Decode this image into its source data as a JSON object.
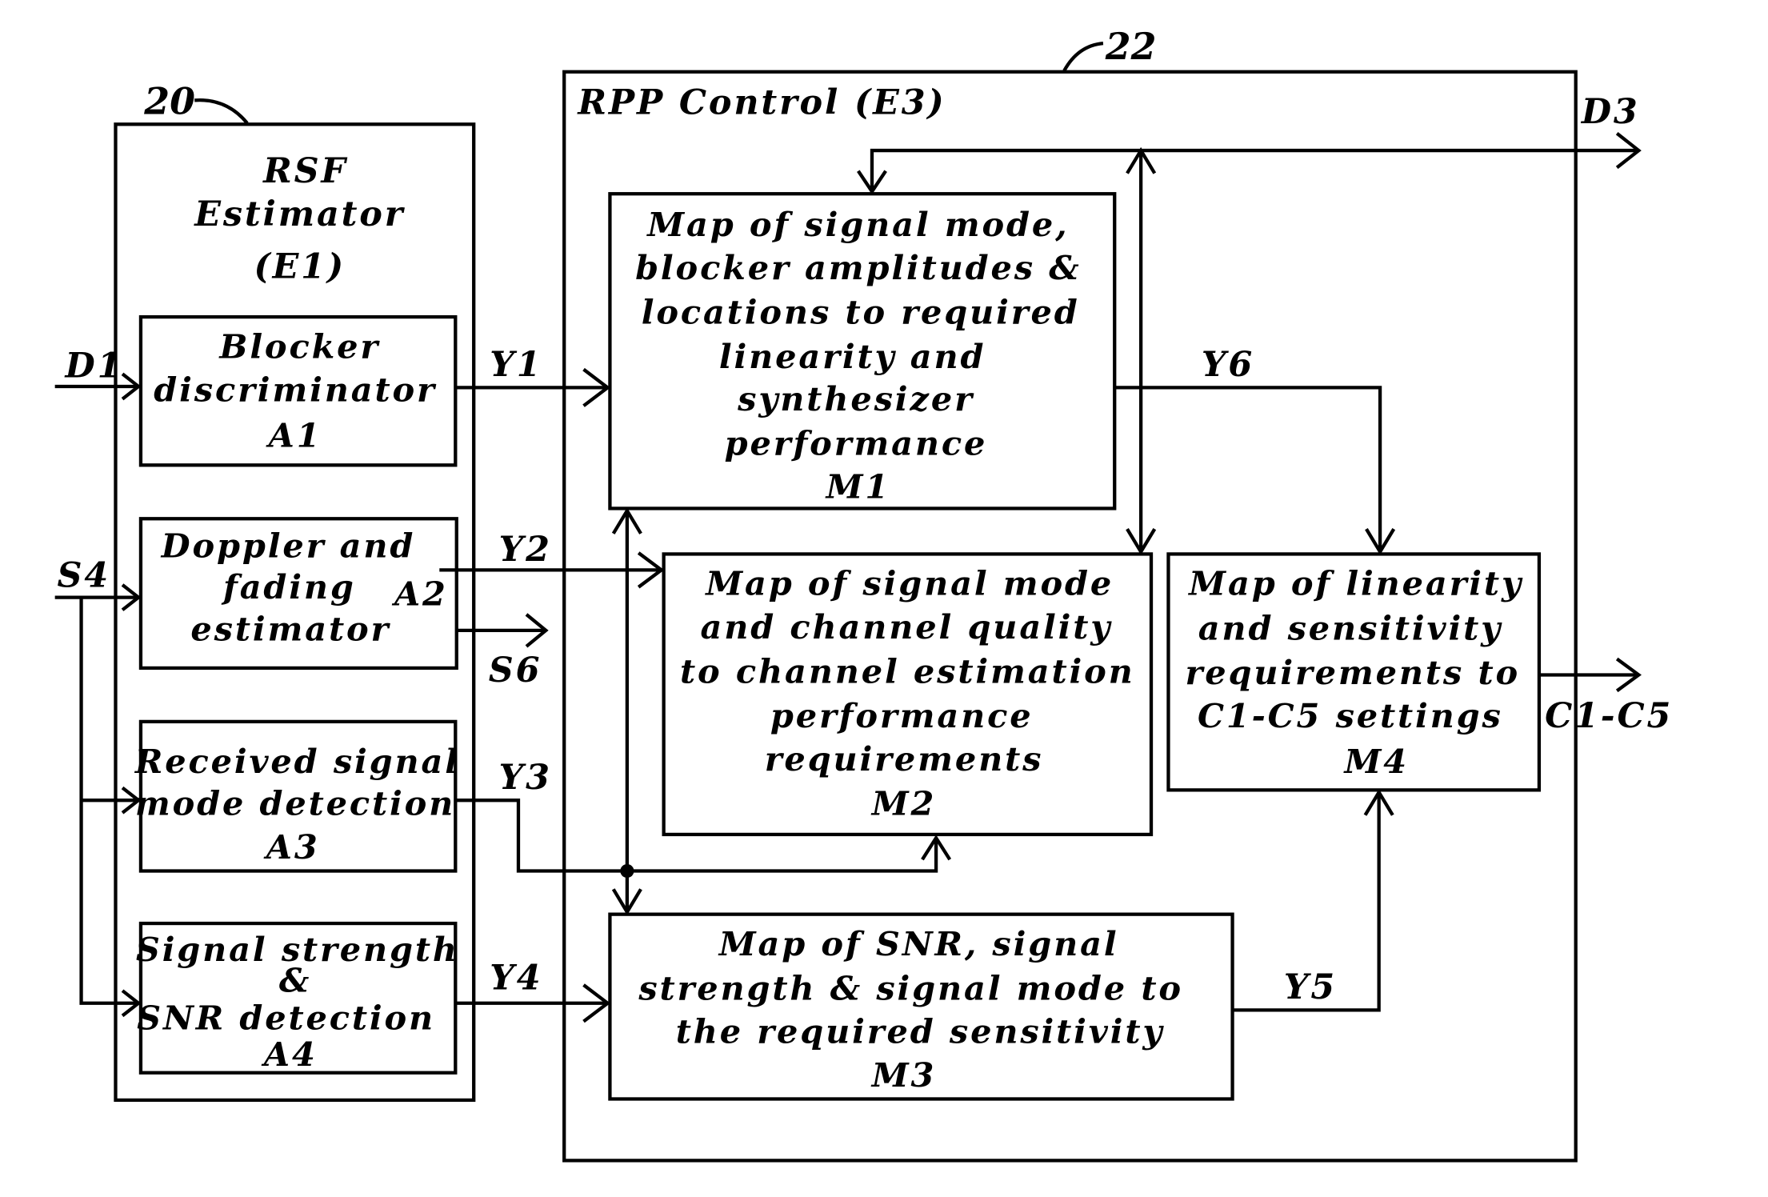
{
  "diagram": {
    "estimator": {
      "ref": "20",
      "title_lines": [
        "RSF",
        "Estimator",
        "(E1)"
      ],
      "blocks": [
        {
          "id": "A1",
          "lines": [
            "Blocker",
            "discriminator",
            "A1"
          ]
        },
        {
          "id": "A2",
          "lines": [
            "Doppler and",
            "fading",
            "estimator"
          ],
          "tag": "A2"
        },
        {
          "id": "A3",
          "lines": [
            "Received signal",
            "mode detection",
            "A3"
          ]
        },
        {
          "id": "A4",
          "lines": [
            "Signal strength",
            "&",
            "SNR detection",
            "A4"
          ]
        }
      ]
    },
    "control": {
      "ref": "22",
      "title": "RPP Control (E3)",
      "blocks": [
        {
          "id": "M1",
          "lines": [
            "Map of signal mode,",
            "blocker amplitudes &",
            "locations to required",
            "linearity and",
            "synthesizer",
            "performance",
            "M1"
          ]
        },
        {
          "id": "M2",
          "lines": [
            "Map of signal mode",
            "and channel quality",
            "to channel estimation",
            "performance",
            "requirements",
            "M2"
          ]
        },
        {
          "id": "M3",
          "lines": [
            "Map of SNR, signal",
            "strength & signal mode to",
            "the required sensitivity",
            "M3"
          ]
        },
        {
          "id": "M4",
          "lines": [
            "Map of linearity",
            "and sensitivity",
            "requirements to",
            "C1-C5 settings",
            "M4"
          ]
        }
      ]
    },
    "signals": {
      "D1": "D1",
      "S4": "S4",
      "S6": "S6",
      "Y1": "Y1",
      "Y2": "Y2",
      "Y3": "Y3",
      "Y4": "Y4",
      "Y5": "Y5",
      "Y6": "Y6",
      "D3": "D3",
      "C1C5": "C1-C5"
    }
  }
}
